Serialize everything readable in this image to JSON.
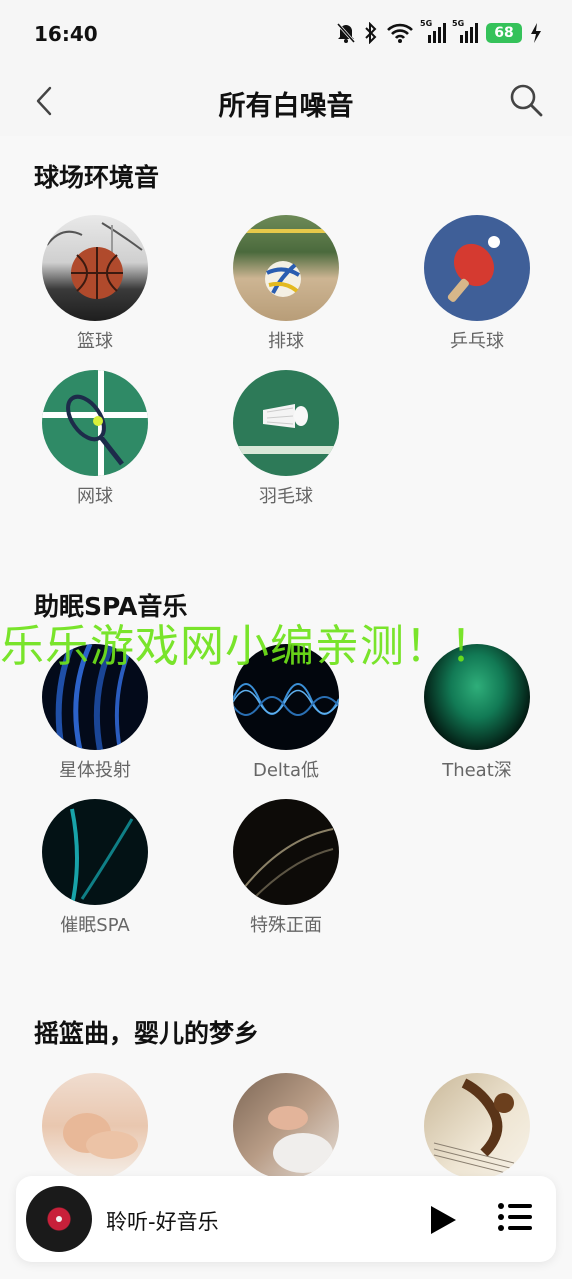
{
  "status": {
    "time": "16:40",
    "battery": "68",
    "net1": "5G",
    "net2": "5G"
  },
  "header": {
    "title": "所有白噪音"
  },
  "sections": [
    {
      "title": "球场环境音",
      "items": [
        {
          "label": "篮球",
          "icon": "basketball-image"
        },
        {
          "label": "排球",
          "icon": "volleyball-image"
        },
        {
          "label": "乒乓球",
          "icon": "table-tennis-image"
        },
        {
          "label": "网球",
          "icon": "tennis-image"
        },
        {
          "label": "羽毛球",
          "icon": "badminton-image"
        }
      ]
    },
    {
      "title": "助眠SPA音乐",
      "items": [
        {
          "label": "星体投射",
          "icon": "blue-light-streaks-image"
        },
        {
          "label": "Delta低",
          "icon": "blue-waves-image"
        },
        {
          "label": "Theat深",
          "icon": "green-waves-image"
        },
        {
          "label": "催眠SPA",
          "icon": "teal-light-image"
        },
        {
          "label": "特殊正面",
          "icon": "dark-light-trails-image"
        }
      ]
    },
    {
      "title": "摇篮曲，婴儿的梦乡",
      "items": [
        {
          "label": "",
          "icon": "sleeping-baby-image"
        },
        {
          "label": "",
          "icon": "baby-hands-image"
        },
        {
          "label": "",
          "icon": "violin-sheet-music-image"
        }
      ]
    }
  ],
  "watermark": "乐乐游戏网小编亲测！！",
  "player": {
    "title": "聆听-好音乐"
  },
  "colors": {
    "watermark": "#6fe31a",
    "battery": "#35c25a",
    "disc_center": "#c8203a"
  }
}
